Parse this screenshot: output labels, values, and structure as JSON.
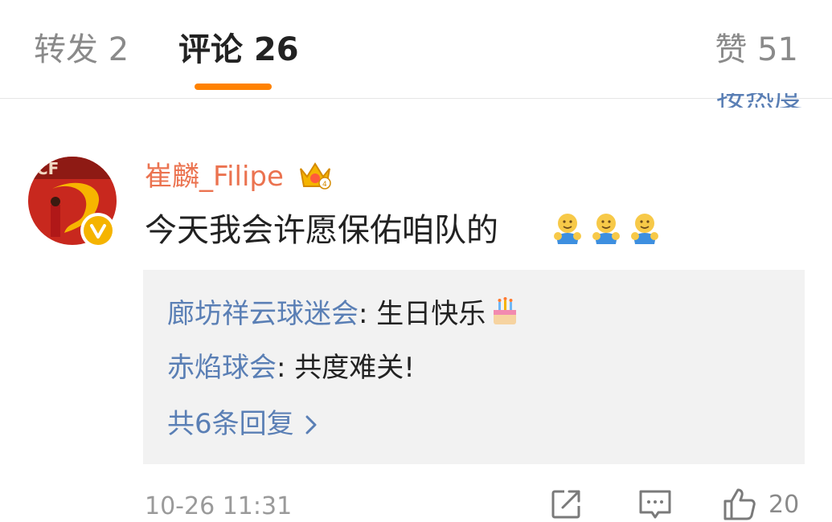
{
  "tabs": {
    "repost": "转发 2",
    "comments": "评论 26",
    "likes": "赞 51"
  },
  "sort_label": "按热度",
  "comment": {
    "username": "崔麟_Filipe",
    "text": "今天我会许愿保佑咱队的",
    "emojis": [
      "hug-emoji",
      "hug-emoji",
      "hug-emoji"
    ],
    "timestamp": "10-26 11:31",
    "like_count": "20"
  },
  "replies": [
    {
      "name": "廊坊祥云球迷会",
      "separator": ": ",
      "text": "生日快乐",
      "emoji": "cake-emoji"
    },
    {
      "name": "赤焰球会",
      "separator": ": ",
      "text": "共度难关!"
    }
  ],
  "more_replies": "共6条回复",
  "colors": {
    "accent": "#ff8200",
    "username": "#eb7350",
    "link": "#5a7fb5",
    "reply_bg": "#f2f2f2"
  }
}
